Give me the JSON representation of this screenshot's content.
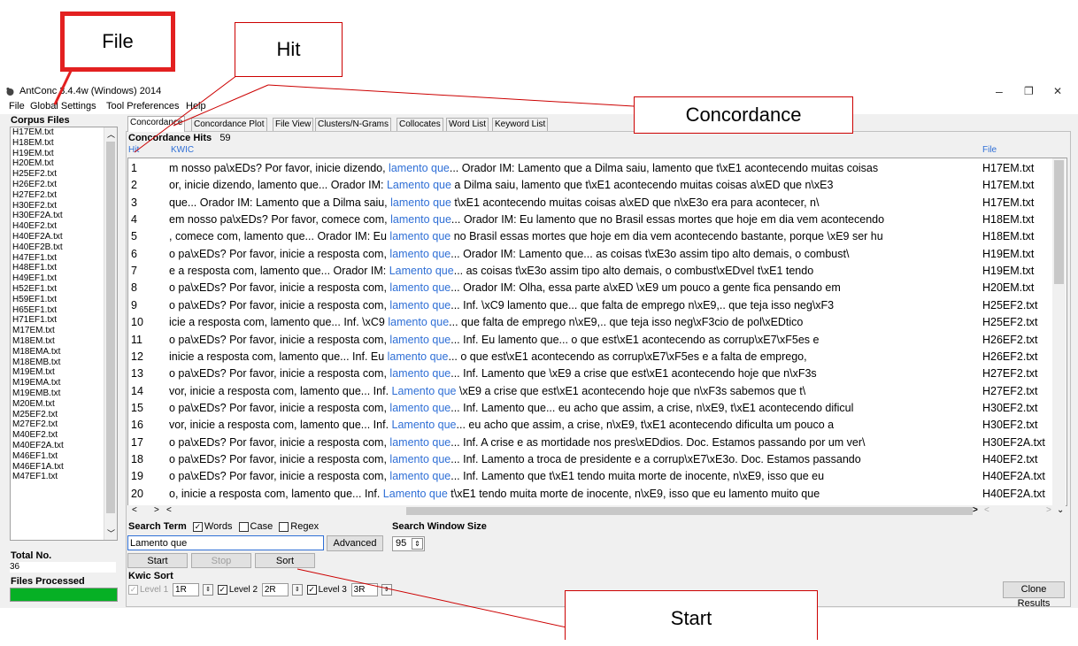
{
  "window": {
    "title": "AntConc 3.4.4w (Windows) 2014",
    "controls": {
      "minimize": "–",
      "restore": "❐",
      "close": "✕"
    }
  },
  "menu": [
    "File",
    "Global Settings",
    "Tool Preferences",
    "Help"
  ],
  "left_panel": {
    "corpus_files_label": "Corpus Files",
    "files": [
      "H17EM.txt",
      "H18EM.txt",
      "H19EM.txt",
      "H20EM.txt",
      "H25EF2.txt",
      "H26EF2.txt",
      "H27EF2.txt",
      "H30EF2.txt",
      "H30EF2A.txt",
      "H40EF2.txt",
      "H40EF2A.txt",
      "H40EF2B.txt",
      "H47EF1.txt",
      "H48EF1.txt",
      "H49EF1.txt",
      "H52EF1.txt",
      "H59EF1.txt",
      "H65EF1.txt",
      "H71EF1.txt",
      "M17EM.txt",
      "M18EM.txt",
      "M18EMA.txt",
      "M18EMB.txt",
      "M19EM.txt",
      "M19EMA.txt",
      "M19EMB.txt",
      "M20EM.txt",
      "M25EF2.txt",
      "M27EF2.txt",
      "M40EF2.txt",
      "M40EF2A.txt",
      "M46EF1.txt",
      "M46EF1A.txt",
      "M47EF1.txt"
    ],
    "total_no_label": "Total No.",
    "total_no_value": "36",
    "files_processed_label": "Files Processed",
    "progress": 1.0
  },
  "tabs": [
    {
      "label": "Concordance",
      "active": true
    },
    {
      "label": "Concordance Plot",
      "active": false
    },
    {
      "label": "File View",
      "active": false
    },
    {
      "label": "Clusters/N-Grams",
      "active": false
    },
    {
      "label": "Collocates",
      "active": false
    },
    {
      "label": "Word List",
      "active": false
    },
    {
      "label": "Keyword List",
      "active": false
    }
  ],
  "concordance": {
    "hits_label": "Concordance Hits",
    "hits_count": "59",
    "columns": {
      "hit": "Hit",
      "kwic": "KWIC",
      "file": "File"
    },
    "rows": [
      {
        "hit": "1",
        "left": "m nosso pa\\xEDs? Por favor, inicie dizendo, ",
        "kw": "lamento que",
        "right": "... Orador IM: Lamento que a Dilma saiu, lamento que t\\xE1 acontecendo muitas coisas",
        "file": "H17EM.txt"
      },
      {
        "hit": "2",
        "left": "or, inicie dizendo, lamento que... Orador IM: ",
        "kw": "Lamento que",
        "right": " a Dilma saiu, lamento que t\\xE1 acontecendo muitas coisas a\\xED que n\\xE3",
        "file": "H17EM.txt"
      },
      {
        "hit": "3",
        "left": "que... Orador IM: Lamento que a Dilma saiu, ",
        "kw": "lamento que",
        "right": " t\\xE1 acontecendo muitas coisas a\\xED que n\\xE3o era para acontecer, n\\",
        "file": "H17EM.txt"
      },
      {
        "hit": "4",
        "left": "em nosso pa\\xEDs? Por favor, comece com, ",
        "kw": "lamento que",
        "right": "... Orador IM: Eu lamento que no Brasil essas mortes que hoje em dia vem acontecendo",
        "file": "H18EM.txt"
      },
      {
        "hit": "5",
        "left": ", comece com, lamento que... Orador IM: Eu ",
        "kw": "lamento que",
        "right": " no Brasil essas mortes que hoje em dia vem acontecendo bastante, porque \\xE9 ser hu",
        "file": "H18EM.txt"
      },
      {
        "hit": "6",
        "left": "o pa\\xEDs? Por favor, inicie a resposta com, ",
        "kw": "lamento que",
        "right": "... Orador IM: Lamento que... as coisas t\\xE3o assim tipo alto demais, o combust\\",
        "file": "H19EM.txt"
      },
      {
        "hit": "7",
        "left": "e a resposta com, lamento que... Orador IM: ",
        "kw": "Lamento que",
        "right": "... as coisas t\\xE3o assim tipo alto demais, o combust\\xEDvel t\\xE1 tendo",
        "file": "H19EM.txt"
      },
      {
        "hit": "8",
        "left": "o pa\\xEDs? Por favor, inicie a resposta com, ",
        "kw": "lamento que",
        "right": "... Orador IM: Olha, essa parte a\\xED \\xE9 um pouco a gente fica pensando em",
        "file": "H20EM.txt"
      },
      {
        "hit": "9",
        "left": "o pa\\xEDs? Por favor, inicie a resposta com, ",
        "kw": "lamento que",
        "right": "... Inf. \\xC9 lamento que... que falta de emprego n\\xE9,.. que teja isso neg\\xF3",
        "file": "H25EF2.txt"
      },
      {
        "hit": "10",
        "left": "icie a resposta com, lamento que... Inf. \\xC9 ",
        "kw": "lamento que",
        "right": "... que falta de emprego n\\xE9,.. que teja isso neg\\xF3cio de pol\\xEDtico",
        "file": "H25EF2.txt"
      },
      {
        "hit": "11",
        "left": "o pa\\xEDs? Por favor, inicie a resposta com, ",
        "kw": "lamento que",
        "right": "... Inf. Eu lamento que... o que est\\xE1 acontecendo as corrup\\xE7\\xF5es e",
        "file": "H26EF2.txt"
      },
      {
        "hit": "12",
        "left": " inicie a resposta com, lamento que... Inf. Eu ",
        "kw": "lamento que",
        "right": "... o que est\\xE1 acontecendo as corrup\\xE7\\xF5es e a falta de emprego,",
        "file": "H26EF2.txt"
      },
      {
        "hit": "13",
        "left": "o pa\\xEDs? Por favor, inicie a resposta com, ",
        "kw": "lamento que",
        "right": "... Inf. Lamento que \\xE9 a crise que est\\xE1 acontecendo hoje que n\\xF3s",
        "file": "H27EF2.txt"
      },
      {
        "hit": "14",
        "left": "vor, inicie a resposta com, lamento que... Inf. ",
        "kw": "Lamento que",
        "right": " \\xE9 a crise que est\\xE1 acontecendo hoje que n\\xF3s sabemos que t\\",
        "file": "H27EF2.txt"
      },
      {
        "hit": "15",
        "left": "o pa\\xEDs? Por favor, inicie a resposta com, ",
        "kw": "lamento que",
        "right": "... Inf. Lamento que... eu acho que assim, a crise, n\\xE9, t\\xE1 acontecendo dificul",
        "file": "H30EF2.txt"
      },
      {
        "hit": "16",
        "left": "vor, inicie a resposta com, lamento que... Inf. ",
        "kw": "Lamento que",
        "right": "... eu acho que assim, a crise, n\\xE9, t\\xE1 acontecendo dificulta um pouco a",
        "file": "H30EF2.txt"
      },
      {
        "hit": "17",
        "left": "o pa\\xEDs? Por favor, inicie a resposta com, ",
        "kw": "lamento que",
        "right": "... Inf. A crise e as mortidade nos pres\\xEDdios. Doc. Estamos passando por um ver\\",
        "file": "H30EF2A.txt"
      },
      {
        "hit": "18",
        "left": "o pa\\xEDs? Por favor, inicie a resposta com, ",
        "kw": "lamento que",
        "right": "... Inf. Lamento a troca de presidente e a corrup\\xE7\\xE3o. Doc. Estamos passando",
        "file": "H40EF2.txt"
      },
      {
        "hit": "19",
        "left": "o pa\\xEDs? Por favor, inicie a resposta com, ",
        "kw": "lamento que",
        "right": "...  Inf. Lamento que t\\xE1 tendo muita morte de inocente, n\\xE9, isso que eu",
        "file": "H40EF2A.txt"
      },
      {
        "hit": "20",
        "left": "o, inicie a resposta com, lamento que... Inf. ",
        "kw": "Lamento que",
        "right": " t\\xE1 tendo muita morte de inocente, n\\xE9, isso que eu lamento muito que",
        "file": "H40EF2A.txt"
      }
    ]
  },
  "search": {
    "term_label": "Search Term",
    "words_label": "Words",
    "words_checked": true,
    "case_label": "Case",
    "case_checked": false,
    "regex_label": "Regex",
    "regex_checked": false,
    "value": "Lamento que",
    "advanced_label": "Advanced",
    "window_size_label": "Search Window Size",
    "window_size_value": "95",
    "start_label": "Start",
    "stop_label": "Stop",
    "sort_label": "Sort"
  },
  "kwic_sort": {
    "title": "Kwic Sort",
    "levels": [
      {
        "label": "Level 1",
        "value": "1R"
      },
      {
        "label": "Level 2",
        "value": "2R"
      },
      {
        "label": "Level 3",
        "value": "3R"
      }
    ]
  },
  "clone_results_label": "Clone Results",
  "annotations": {
    "file": "File",
    "hit": "Hit",
    "concordance": "Concordance",
    "start": "Start",
    "annotation_color": "#e32020"
  },
  "colors": {
    "keyword": "#2f6fd6",
    "progress": "#06b025"
  }
}
